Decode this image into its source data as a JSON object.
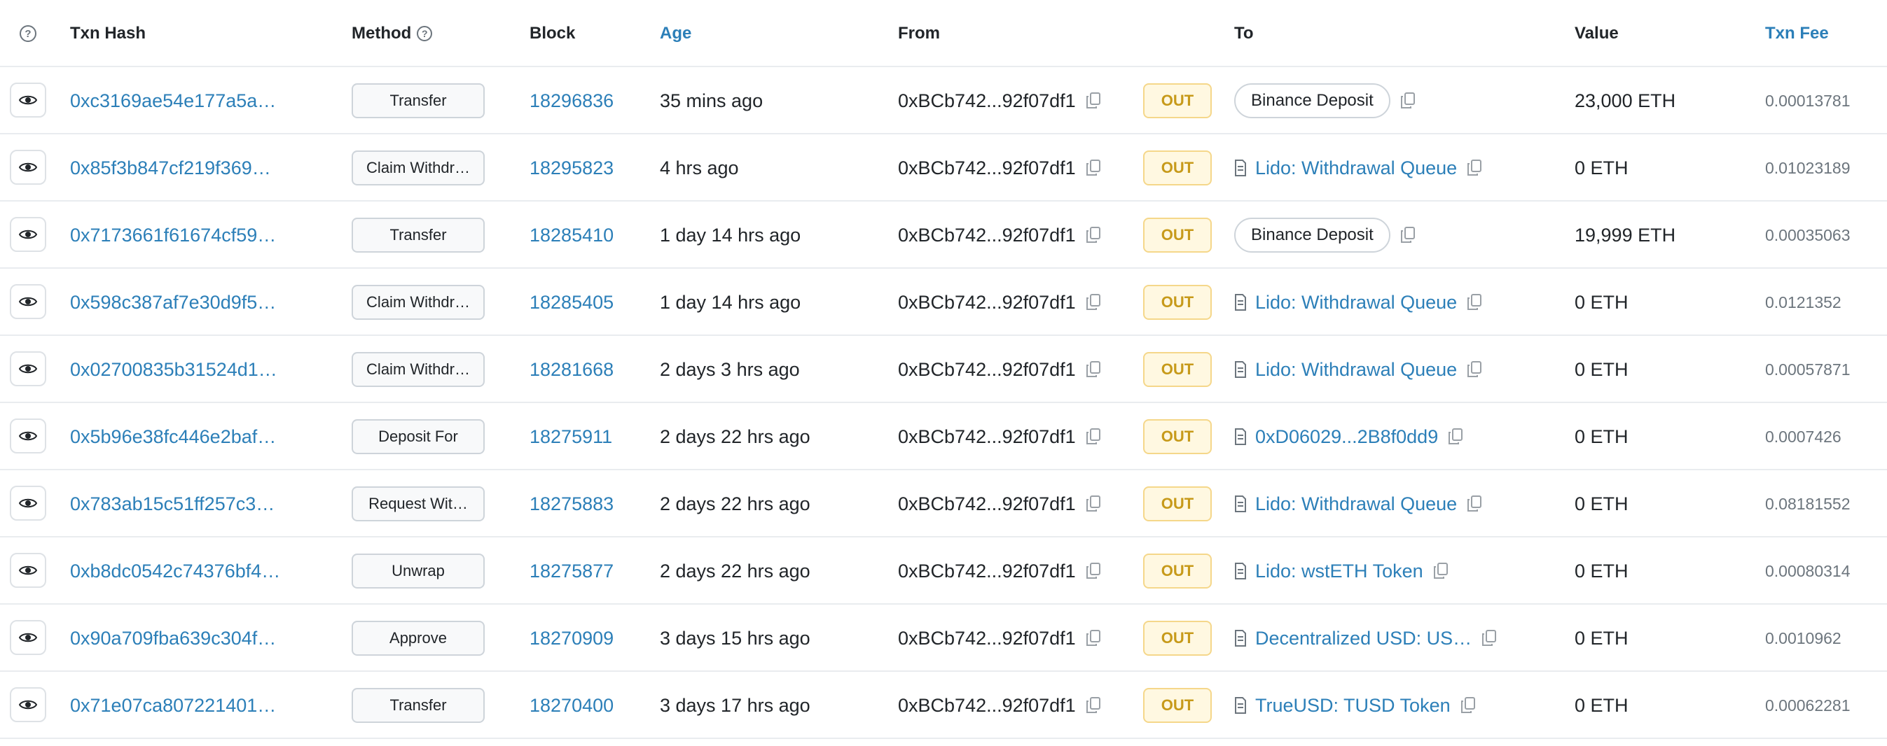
{
  "headers": {
    "txn_hash": "Txn Hash",
    "method": "Method",
    "block": "Block",
    "age": "Age",
    "from": "From",
    "to": "To",
    "value": "Value",
    "txn_fee": "Txn Fee"
  },
  "colors": {
    "link": "#2c7fb8",
    "out_badge_bg": "#fff8e1",
    "out_badge_text": "#c79a1a"
  },
  "rows": [
    {
      "hash": "0xc3169ae54e177a5a…",
      "method": "Transfer",
      "block": "18296836",
      "age": "35 mins ago",
      "from": "0xBCb742...92f07df1",
      "direction": "OUT",
      "to": "Binance Deposit",
      "to_type": "pill",
      "value": "23,000 ETH",
      "fee": "0.00013781"
    },
    {
      "hash": "0x85f3b847cf219f369…",
      "method": "Claim Withdr…",
      "block": "18295823",
      "age": "4 hrs ago",
      "from": "0xBCb742...92f07df1",
      "direction": "OUT",
      "to": "Lido: Withdrawal Queue",
      "to_type": "contract",
      "value": "0 ETH",
      "fee": "0.01023189"
    },
    {
      "hash": "0x7173661f61674cf59…",
      "method": "Transfer",
      "block": "18285410",
      "age": "1 day 14 hrs ago",
      "from": "0xBCb742...92f07df1",
      "direction": "OUT",
      "to": "Binance Deposit",
      "to_type": "pill",
      "value": "19,999 ETH",
      "fee": "0.00035063"
    },
    {
      "hash": "0x598c387af7e30d9f5…",
      "method": "Claim Withdr…",
      "block": "18285405",
      "age": "1 day 14 hrs ago",
      "from": "0xBCb742...92f07df1",
      "direction": "OUT",
      "to": "Lido: Withdrawal Queue",
      "to_type": "contract",
      "value": "0 ETH",
      "fee": "0.0121352"
    },
    {
      "hash": "0x02700835b31524d1…",
      "method": "Claim Withdr…",
      "block": "18281668",
      "age": "2 days 3 hrs ago",
      "from": "0xBCb742...92f07df1",
      "direction": "OUT",
      "to": "Lido: Withdrawal Queue",
      "to_type": "contract",
      "value": "0 ETH",
      "fee": "0.00057871"
    },
    {
      "hash": "0x5b96e38fc446e2baf…",
      "method": "Deposit For",
      "block": "18275911",
      "age": "2 days 22 hrs ago",
      "from": "0xBCb742...92f07df1",
      "direction": "OUT",
      "to": "0xD06029...2B8f0dd9",
      "to_type": "contract",
      "value": "0 ETH",
      "fee": "0.0007426"
    },
    {
      "hash": "0x783ab15c51ff257c3…",
      "method": "Request Wit…",
      "block": "18275883",
      "age": "2 days 22 hrs ago",
      "from": "0xBCb742...92f07df1",
      "direction": "OUT",
      "to": "Lido: Withdrawal Queue",
      "to_type": "contract",
      "value": "0 ETH",
      "fee": "0.08181552"
    },
    {
      "hash": "0xb8dc0542c74376bf4…",
      "method": "Unwrap",
      "block": "18275877",
      "age": "2 days 22 hrs ago",
      "from": "0xBCb742...92f07df1",
      "direction": "OUT",
      "to": "Lido: wstETH Token",
      "to_type": "contract",
      "value": "0 ETH",
      "fee": "0.00080314"
    },
    {
      "hash": "0x90a709fba639c304f…",
      "method": "Approve",
      "block": "18270909",
      "age": "3 days 15 hrs ago",
      "from": "0xBCb742...92f07df1",
      "direction": "OUT",
      "to": "Decentralized USD: US…",
      "to_type": "contract",
      "value": "0 ETH",
      "fee": "0.0010962"
    },
    {
      "hash": "0x71e07ca807221401…",
      "method": "Transfer",
      "block": "18270400",
      "age": "3 days 17 hrs ago",
      "from": "0xBCb742...92f07df1",
      "direction": "OUT",
      "to": "TrueUSD: TUSD Token",
      "to_type": "contract",
      "value": "0 ETH",
      "fee": "0.00062281"
    }
  ]
}
